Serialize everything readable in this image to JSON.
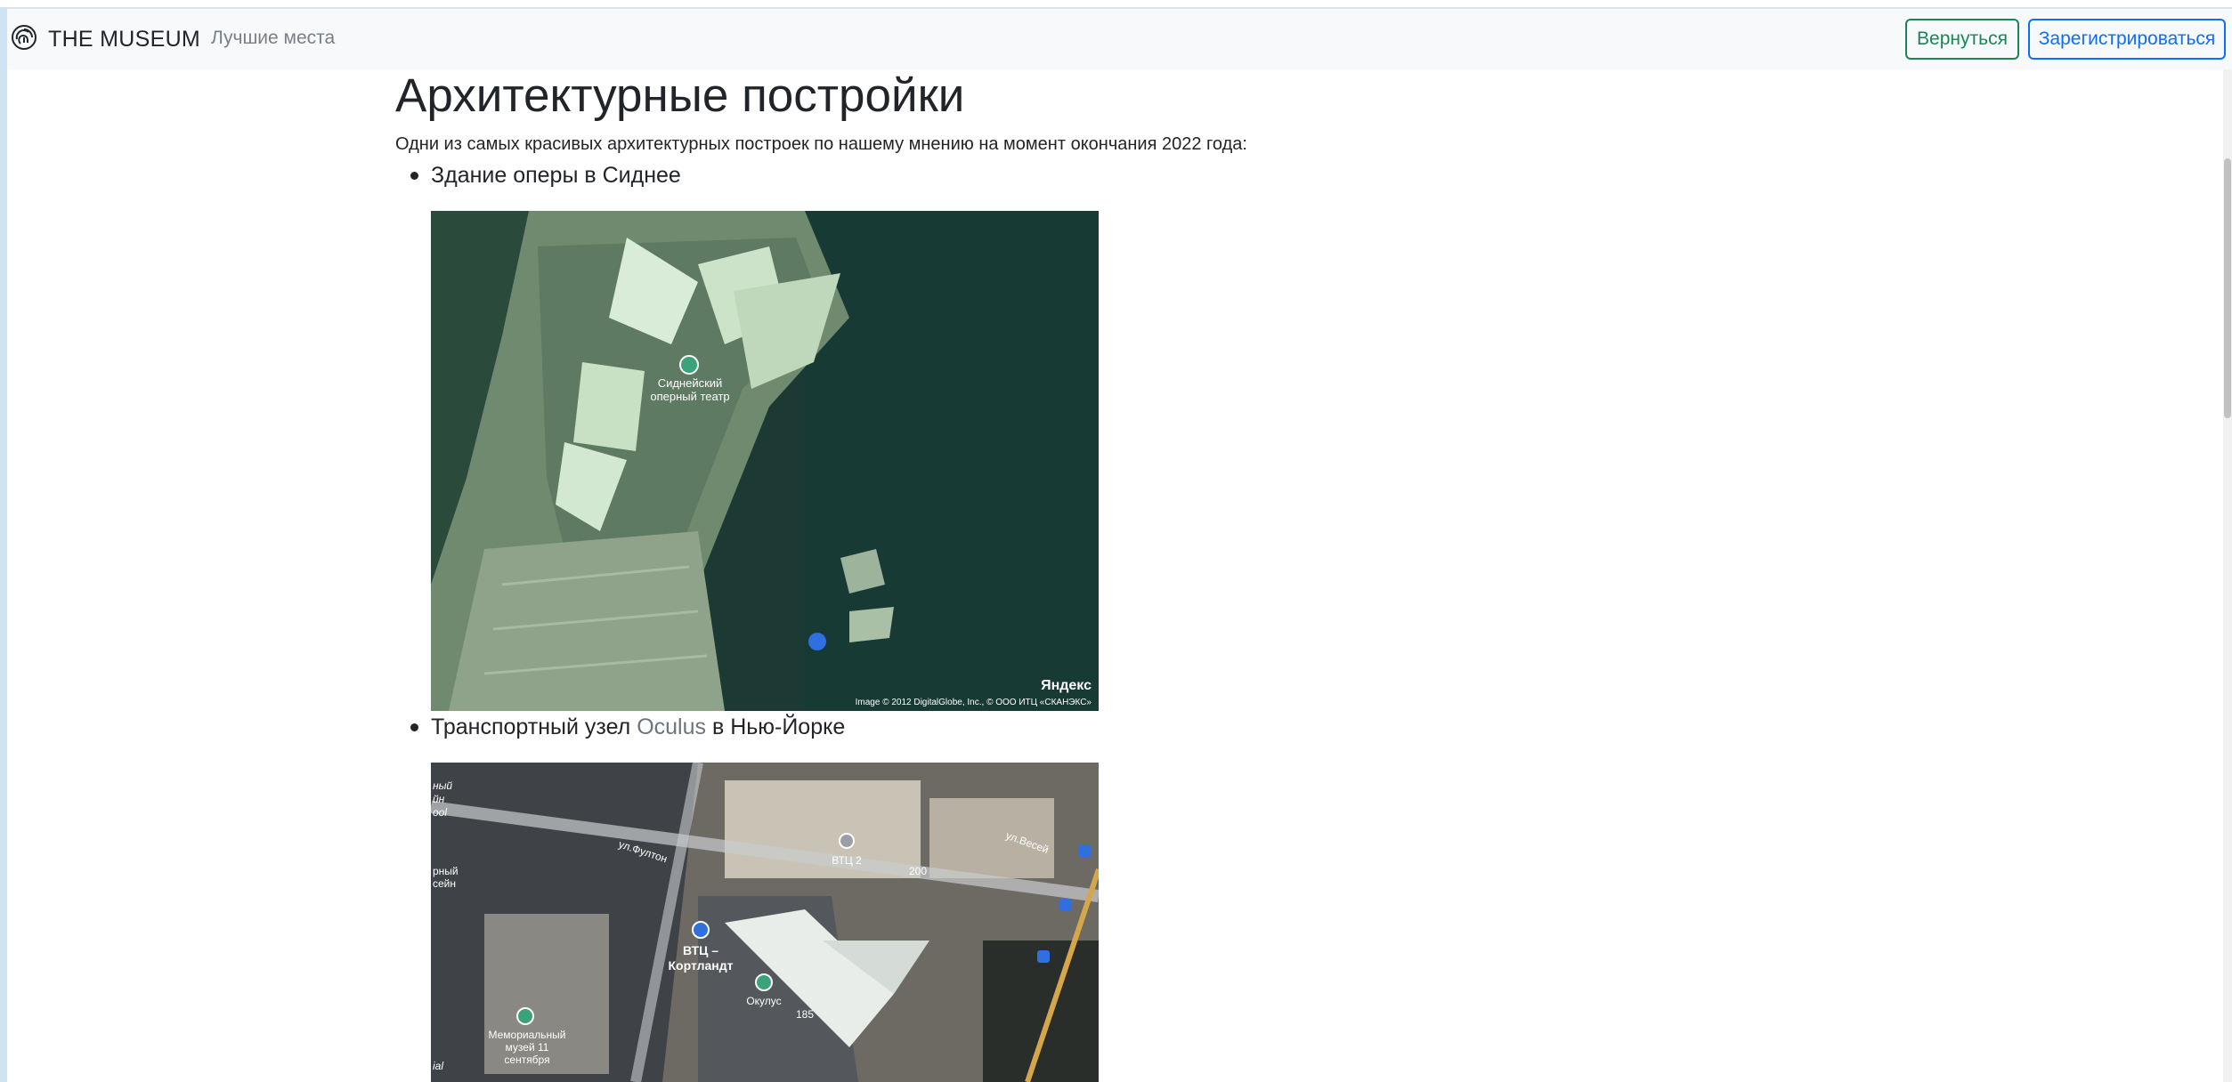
{
  "navbar": {
    "brand": "THE MUSEUM",
    "brand_icon": "fingerprint-icon",
    "link": "Лучшие места",
    "back_button": "Вернуться",
    "register_button": "Зарегистрироваться"
  },
  "content": {
    "title": "Архитектурные постройки",
    "intro": "Одни из самых красивых архитектурных построек по нашему мнению на момент окончания 2022 года:",
    "items": [
      {
        "title": "Здание оперы в Сиднее",
        "map": {
          "poi_label_1": "Сиднейский",
          "poi_label_2": "оперный театр",
          "attribution": "Image © 2012 DigitalGlobe, Inc., © ООО ИТЦ «СКАНЭКС»",
          "logo": "Яндекс"
        }
      },
      {
        "title_before": "Транспортный узел ",
        "title_highlight": "Oculus",
        "title_after": " в Нью-Йорке",
        "map": {
          "street_1": "ул.Фултон",
          "street_2": "ул.Весей",
          "metro_1": "ВТЦ –",
          "metro_2": "Кортландт",
          "poi_oculus": "Окулус",
          "wtc2": "ВТЦ 2",
          "num_200": "200",
          "num_185": "185",
          "museum_1": "Мемориальный",
          "museum_2": "музей 11",
          "museum_3": "сентября",
          "edge_1": "рный",
          "edge_2": "сейн",
          "edge_3": "ный",
          "edge_4": "йн",
          "edge_5": "ool",
          "edge_6": "ial"
        }
      }
    ]
  },
  "colors": {
    "navbar_bg": "#f8f9fa",
    "success": "#198754",
    "primary": "#0d6efd",
    "highlight_text": "#6c757d"
  }
}
